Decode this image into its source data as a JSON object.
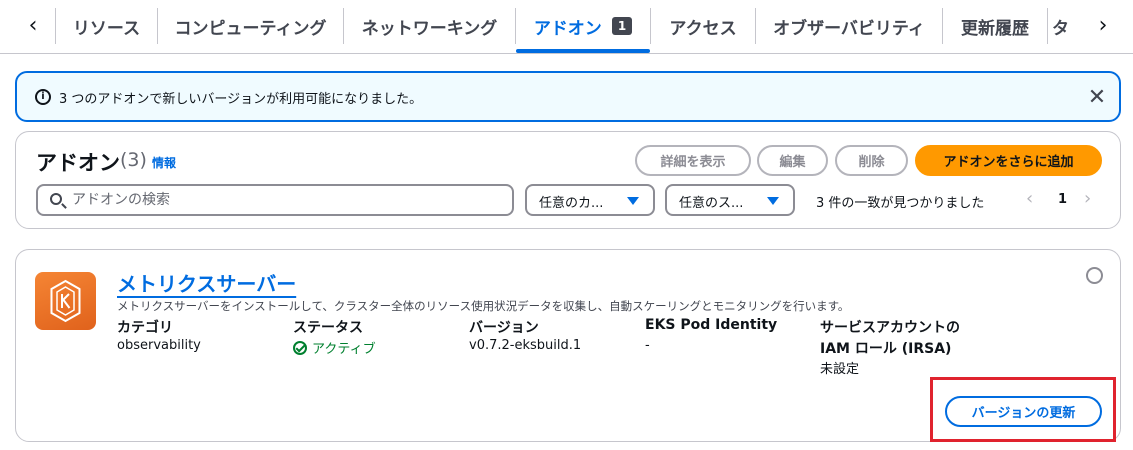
{
  "tabs": {
    "items": [
      "リソース",
      "コンピューティング",
      "ネットワーキング",
      "アドオン",
      "アクセス",
      "オブザーバビリティ",
      "更新履歴",
      "タ"
    ],
    "active_badge": "1"
  },
  "flash": {
    "text": "3 つのアドオンで新しいバージョンが利用可能になりました。",
    "info_glyph": "i",
    "close_glyph": "✕"
  },
  "header": {
    "title": "アドオン",
    "count": "(3)",
    "info_link": "情報",
    "buttons": {
      "view_details": "詳細を表示",
      "edit": "編集",
      "delete": "削除",
      "add_more": "アドオンをさらに追加"
    },
    "search_placeholder": "アドオンの検索",
    "filter_category": "任意のカ...",
    "filter_status": "任意のス...",
    "match_text": "3 件の一致が見つかりました",
    "page_number": "1"
  },
  "addon": {
    "name": "メトリクスサーバー",
    "description": "メトリクスサーバーをインストールして、クラスター全体のリソース使用状況データを収集し、自動スケーリングとモニタリングを行います。",
    "labels": {
      "category": "カテゴリ",
      "status": "ステータス",
      "version": "バージョン",
      "pod_identity": "EKS Pod Identity",
      "service_account_line1": "サービスアカウントの",
      "service_account_line2": "IAM ロール (IRSA)"
    },
    "values": {
      "category": "observability",
      "status": "アクティブ",
      "version": "v0.7.2-eksbuild.1",
      "pod_identity": "-",
      "service_account": "未設定"
    },
    "update_button": "バージョンの更新"
  },
  "colors": {
    "accent": "#006ce0",
    "primary_button": "#ff9900",
    "status_active": "#00802f",
    "highlight_box": "#e0232e"
  }
}
